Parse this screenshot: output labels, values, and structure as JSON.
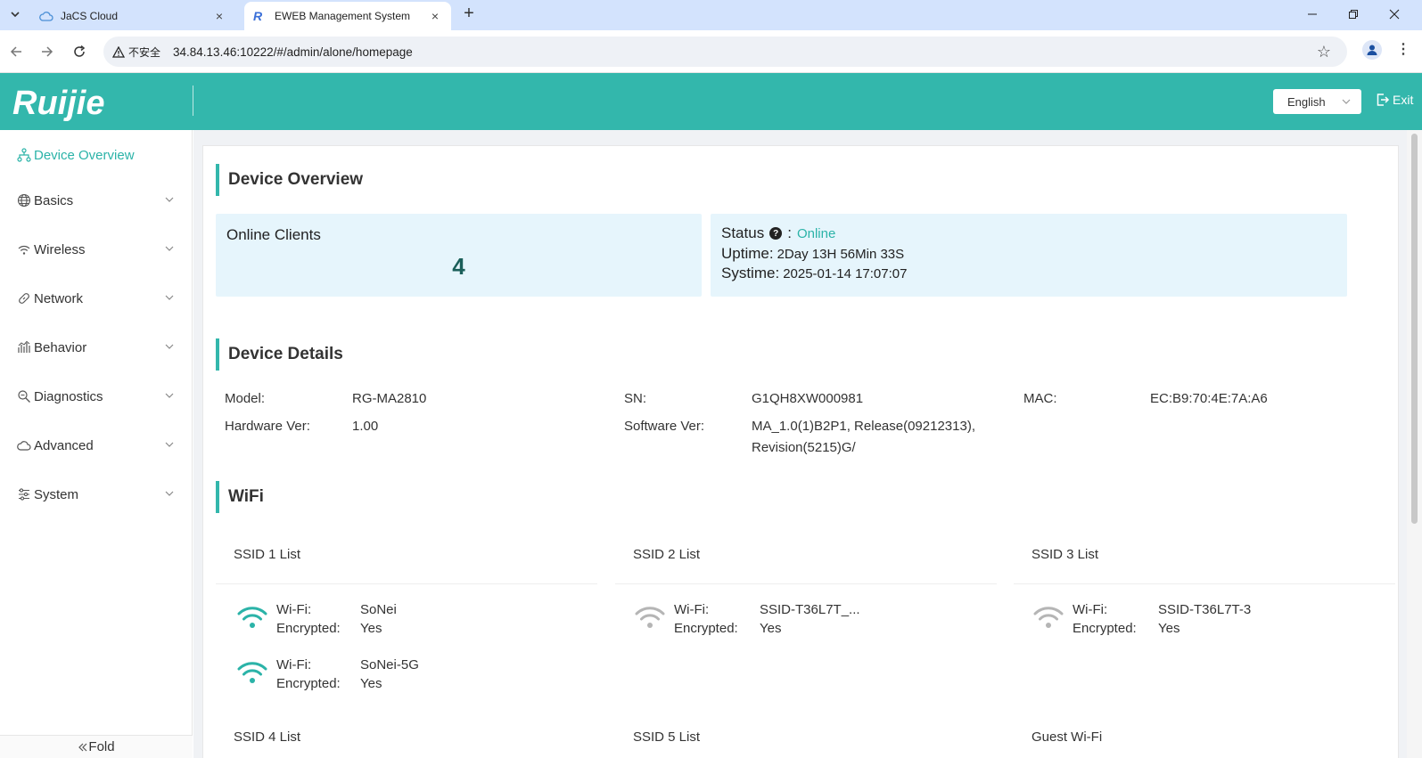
{
  "browser": {
    "tabs": [
      {
        "title": "JaCS Cloud",
        "close": "×"
      },
      {
        "title": "EWEB Management System",
        "close": "×"
      }
    ],
    "new_tab": "+",
    "security_label": "不安全",
    "url": "34.84.13.46:10222/#/admin/alone/homepage"
  },
  "header": {
    "logo_text": "Ruijie",
    "language": "English",
    "exit_label": "Exit"
  },
  "sidebar": {
    "items": [
      {
        "label": "Device Overview",
        "icon": "topology-icon",
        "active": true
      },
      {
        "label": "Basics",
        "icon": "globe-icon"
      },
      {
        "label": "Wireless",
        "icon": "wifi-icon"
      },
      {
        "label": "Network",
        "icon": "link-icon"
      },
      {
        "label": "Behavior",
        "icon": "bar-chart-icon"
      },
      {
        "label": "Diagnostics",
        "icon": "search-icon"
      },
      {
        "label": "Advanced",
        "icon": "cloud-icon"
      },
      {
        "label": "System",
        "icon": "sliders-icon"
      }
    ],
    "fold_label": "Fold"
  },
  "overview": {
    "title": "Device Overview",
    "online_clients_label": "Online Clients",
    "online_clients_value": "4",
    "status_label": "Status",
    "status_sep": ":",
    "status_value": "Online",
    "uptime_label": "Uptime:",
    "uptime_value": "2Day 13H 56Min 33S",
    "systime_label": "Systime:",
    "systime_value": "2025-01-14 17:07:07"
  },
  "details": {
    "title": "Device Details",
    "model_label": "Model:",
    "model_value": "RG-MA2810",
    "sn_label": "SN:",
    "sn_value": "G1QH8XW000981",
    "mac_label": "MAC:",
    "mac_value": "EC:B9:70:4E:7A:A6",
    "hw_label": "Hardware Ver:",
    "hw_value": "1.00",
    "sw_label": "Software Ver:",
    "sw_value_line1": "MA_1.0(1)B2P1, Release(09212313),",
    "sw_value_line2": "Revision(5215)G/"
  },
  "wifi": {
    "title": "WiFi",
    "wifi_key": "Wi-Fi:",
    "enc_key": "Encrypted:",
    "lists": [
      {
        "head": "SSID 1 List",
        "entries": [
          {
            "ssid": "SoNei",
            "encrypted": "Yes",
            "active": true
          },
          {
            "ssid": "SoNei-5G",
            "encrypted": "Yes",
            "active": true
          }
        ]
      },
      {
        "head": "SSID 2 List",
        "entries": [
          {
            "ssid": "SSID-T36L7T_...",
            "encrypted": "Yes",
            "active": false
          }
        ]
      },
      {
        "head": "SSID 3 List",
        "entries": [
          {
            "ssid": "SSID-T36L7T-3",
            "encrypted": "Yes",
            "active": false
          }
        ]
      }
    ],
    "more_heads": [
      "SSID 4 List",
      "SSID 5 List",
      "Guest Wi-Fi"
    ]
  },
  "colors": {
    "brand": "#33b7ac",
    "accent_text": "#2bb3a8",
    "stat_bg": "#e6f5fc",
    "wifi_active": "#2bb3a8",
    "wifi_inactive": "#b5b5b5"
  }
}
